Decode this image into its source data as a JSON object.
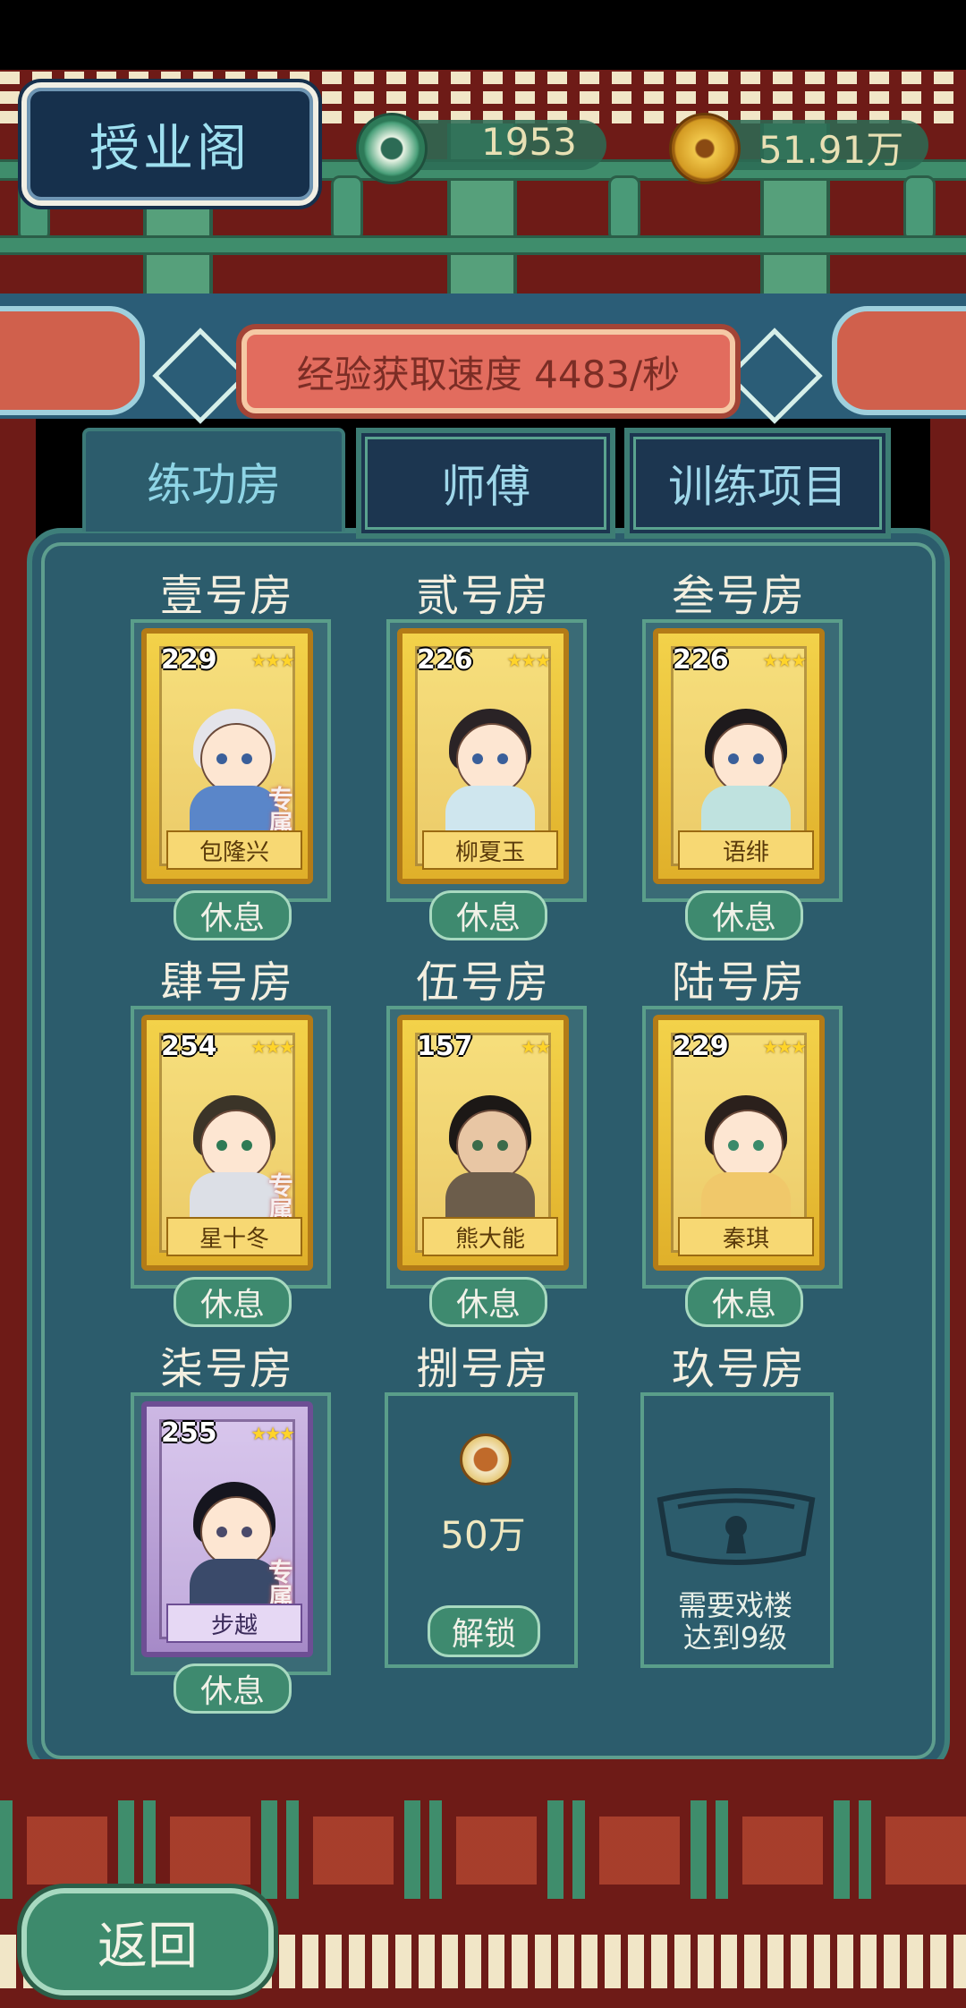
{
  "header": {
    "title": "授业阁",
    "resources": [
      {
        "icon": "jade-coin-icon",
        "value": "1953"
      },
      {
        "icon": "copper-coin-icon",
        "value": "51.91万"
      }
    ]
  },
  "banner": {
    "exp_rate": "经验获取速度 4483/秒"
  },
  "tabs": [
    {
      "label": "练功房",
      "active": true
    },
    {
      "label": "师傅",
      "active": false
    },
    {
      "label": "训练项目",
      "active": false
    }
  ],
  "rooms": [
    {
      "title": "壹号房",
      "level": "229",
      "stars": 3,
      "name": "包隆兴",
      "badge": "专属",
      "card": "gold",
      "action": "休息"
    },
    {
      "title": "贰号房",
      "level": "226",
      "stars": 3,
      "name": "柳夏玉",
      "badge": "",
      "card": "gold",
      "action": "休息"
    },
    {
      "title": "叁号房",
      "level": "226",
      "stars": 3,
      "name": "语绯",
      "badge": "",
      "card": "gold",
      "action": "休息"
    },
    {
      "title": "肆号房",
      "level": "254",
      "stars": 3,
      "name": "星十冬",
      "badge": "专属",
      "card": "gold",
      "action": "休息"
    },
    {
      "title": "伍号房",
      "level": "157",
      "stars": 2,
      "name": "熊大能",
      "badge": "",
      "card": "gold",
      "action": "休息"
    },
    {
      "title": "陆号房",
      "level": "229",
      "stars": 3,
      "name": "秦琪",
      "badge": "",
      "card": "gold",
      "action": "休息"
    },
    {
      "title": "柒号房",
      "level": "255",
      "stars": 3,
      "name": "步越",
      "badge": "专属",
      "card": "purple",
      "action": "休息"
    },
    {
      "title": "捌号房",
      "cost": "50万",
      "action": "解锁"
    },
    {
      "title": "玖号房",
      "lock_text_1": "需要戏楼",
      "lock_text_2": "达到9级"
    }
  ],
  "footer": {
    "back_label": "返回"
  },
  "colors": {
    "panel": "#2c5c6c",
    "wall_red": "#6e1b17",
    "jade_green": "#3e8a6f",
    "gold_card": "#f3d24a",
    "purple_card": "#cdb8e4"
  }
}
